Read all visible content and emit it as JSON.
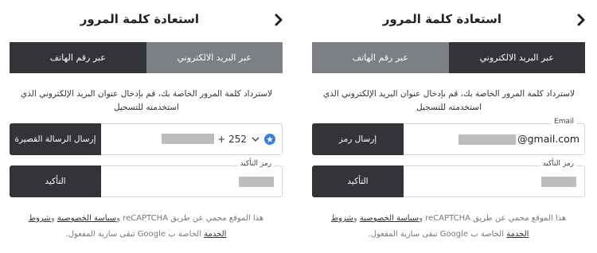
{
  "title": "استعادة كلمة المرور",
  "tabs": {
    "email": "عبر البريد الالكتروني",
    "phone": "عبر رقم الهاتف"
  },
  "description": "لاسترداد كلمة المرور الخاصة بك، قم بإدخال عنوان البريد الإلكتروني الذي استخدمته للتسجيل",
  "send_sms_label": "إرسال الرسالة القصيرة",
  "send_code_label": "إرسال رمز",
  "confirm_label": "التأكيد",
  "code_field_label": "رمز التأكيد",
  "email_field_label": "Email",
  "email_suffix": "@gmail.com",
  "country_code": "+ 252",
  "footer": {
    "text1": "هذا الموقع محمي عن طريق reCAPTCHA و",
    "privacy": "سياسة الخصوصية",
    "and": " و",
    "terms": "شروط",
    "service": "الخدمة",
    "text2": " الخاصة ب Google تبقى سارية المفعول."
  },
  "colors": {
    "dark": "#333437",
    "inactive_tab": "#7c7f84",
    "flag": "#3b82d6"
  }
}
